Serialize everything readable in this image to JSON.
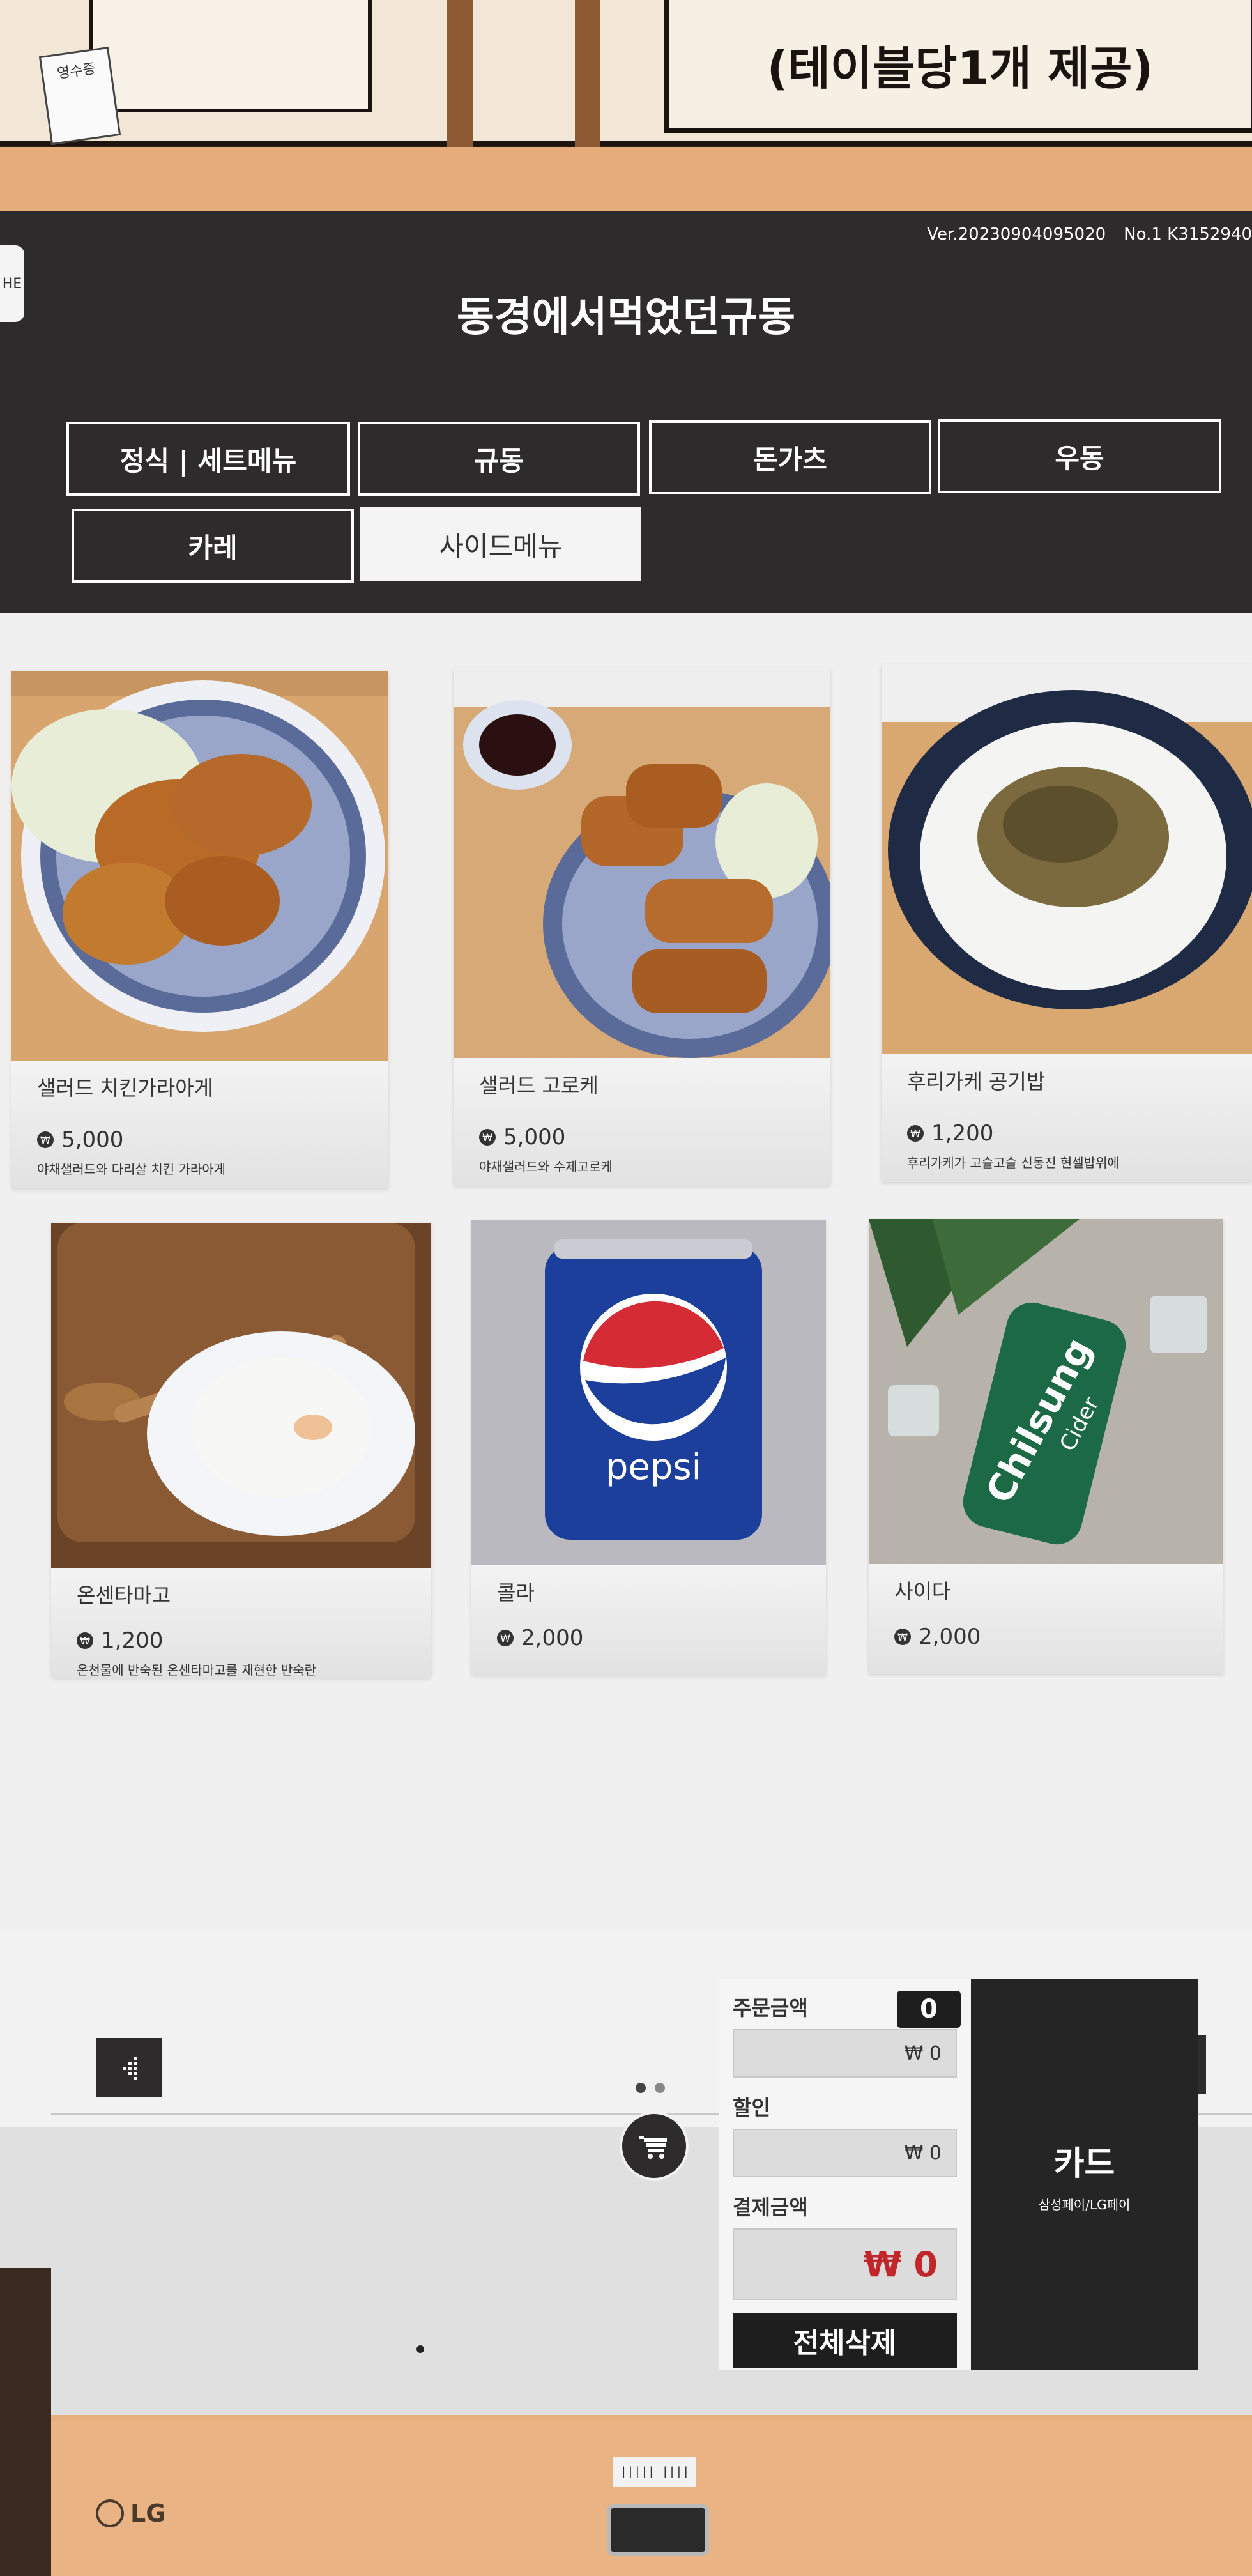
{
  "scene": {
    "sign_right_text": "(테이블당1개 제공)",
    "receipt_stand_text": "영수증"
  },
  "header": {
    "version": "Ver.20230904095020",
    "terminal_no": "No.1 K3152940",
    "home_tab_label": "HE",
    "store_title": "동경에서먹었던규동"
  },
  "categories": [
    {
      "label": "정식 | 세트메뉴",
      "active": false
    },
    {
      "label": "규동",
      "active": false
    },
    {
      "label": "돈가츠",
      "active": false
    },
    {
      "label": "우동",
      "active": false
    },
    {
      "label": "카레",
      "active": false
    },
    {
      "label": "사이드메뉴",
      "active": true
    }
  ],
  "products": [
    {
      "name": "샐러드 치킨가라아게",
      "price": "5,000",
      "desc": "야채샐러드와 다리살 치킨 가라아게"
    },
    {
      "name": "샐러드 고로케",
      "price": "5,000",
      "desc": "야채샐러드와 수제고로케"
    },
    {
      "name": "후리가케 공기밥",
      "price": "1,200",
      "desc": "후리가케가 고슬고슬 신동진 현셀밥위에"
    },
    {
      "name": "온센타마고",
      "price": "1,200",
      "desc": "온천물에 반숙된 온센타마고를 재현한 반숙란"
    },
    {
      "name": "콜라",
      "price": "2,000",
      "desc": ""
    },
    {
      "name": "사이다",
      "price": "2,000",
      "desc": ""
    }
  ],
  "product_images": {
    "pepsi_text": "pepsi",
    "chilsung_text": "Chilsung",
    "chilsung_sub": "Cider"
  },
  "summary": {
    "order_label": "주문금액",
    "order_count": "0",
    "order_amount": "₩ 0",
    "discount_label": "할인",
    "discount_amount": "₩ 0",
    "payment_label": "결제금액",
    "payment_amount": "₩ 0",
    "clear_label": "전체삭제"
  },
  "payment_button": {
    "label": "카드",
    "sublabel": "삼성페이/LG페이"
  },
  "bezel": {
    "brand": "LG",
    "barcode_text": "||||| ||||"
  },
  "colors": {
    "header_bg": "#2d2b2c",
    "accent_red": "#c0262a",
    "kiosk_body": "#e8b07e"
  },
  "icons": [
    "won-icon",
    "arrow-left-icon",
    "arrow-right-icon",
    "cart-icon"
  ]
}
